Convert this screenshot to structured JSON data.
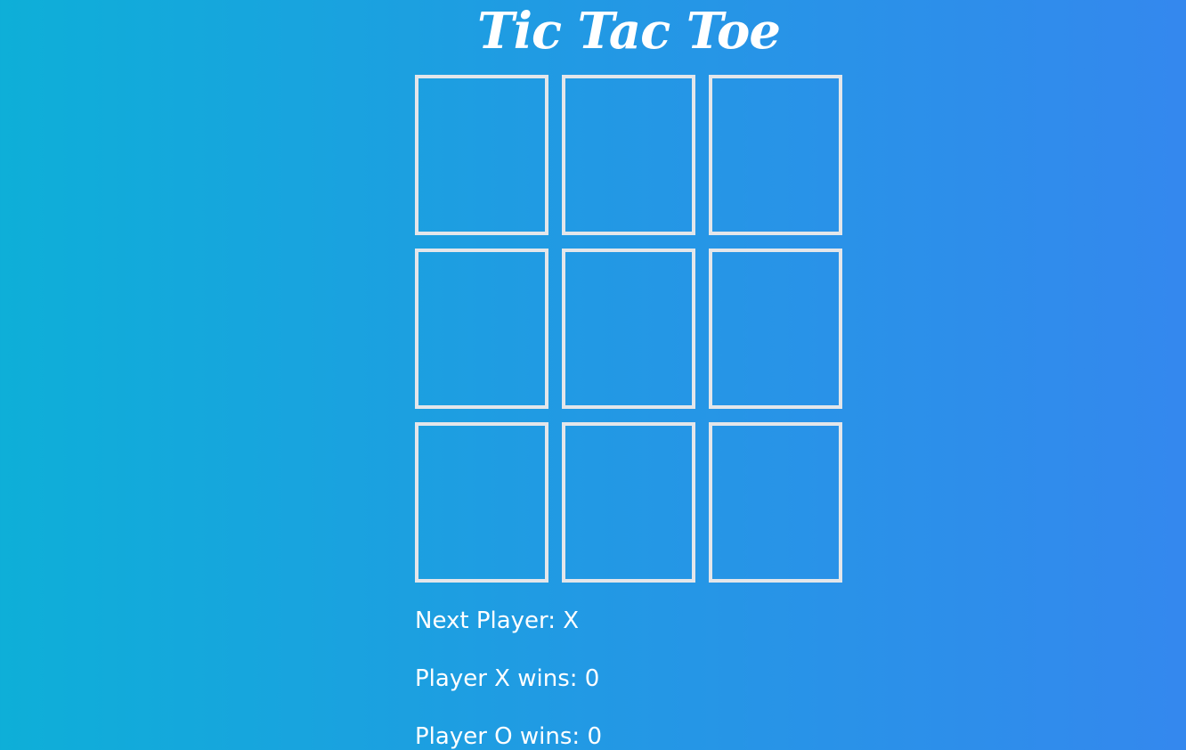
{
  "title": "Tic Tac Toe",
  "board": {
    "cells": [
      "",
      "",
      "",
      "",
      "",
      "",
      "",
      "",
      ""
    ]
  },
  "status": {
    "next_player": "Next Player: X",
    "x_wins": "Player X wins: 0",
    "o_wins": "Player O wins: 0"
  },
  "colors": {
    "background_start": "#0eafd8",
    "background_end": "#3488ee",
    "cell_border": "#e3e6ea",
    "text": "#ffffff"
  }
}
